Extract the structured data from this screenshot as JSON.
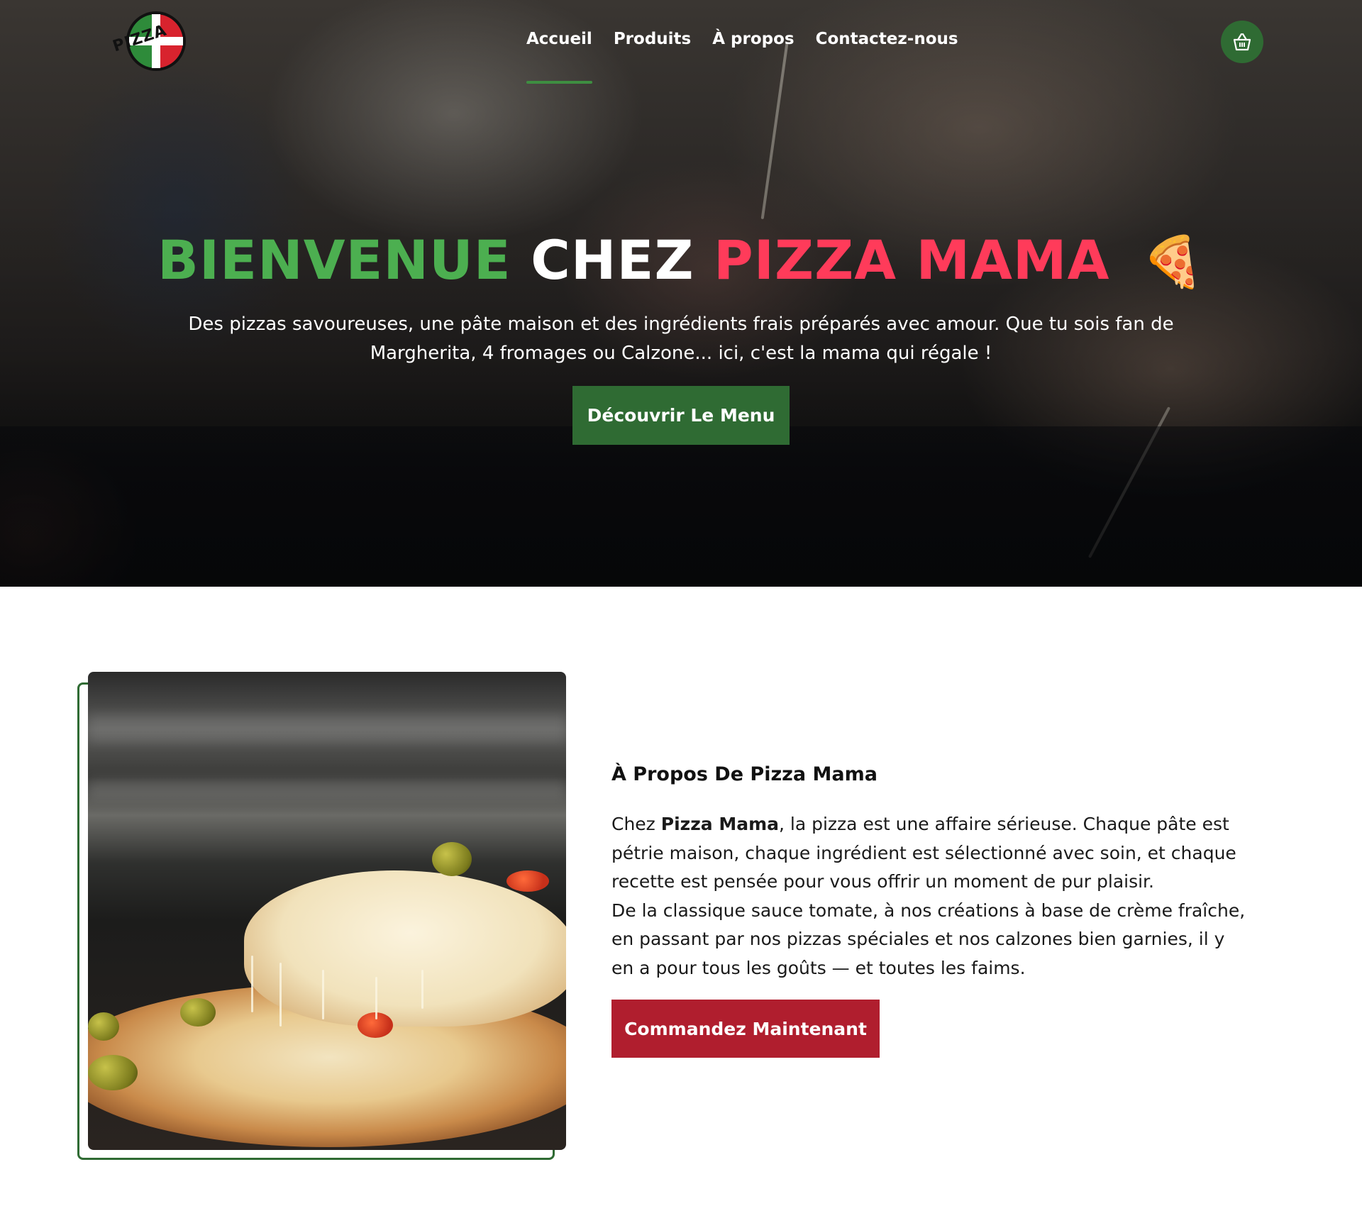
{
  "brand": {
    "logo_text": "PIZZA",
    "colors": {
      "green": "#4caf50",
      "dark_green": "#2f6b33",
      "red": "#ff3b5a",
      "button_red": "#b01e2e"
    }
  },
  "nav": {
    "items": [
      {
        "label": "Accueil",
        "active": true
      },
      {
        "label": "Produits",
        "active": false
      },
      {
        "label": "À propos",
        "active": false
      },
      {
        "label": "Contactez-nous",
        "active": false
      }
    ],
    "cart_icon": "basket-icon"
  },
  "hero": {
    "title_part1": "BIENVENUE",
    "title_part2": "CHEZ",
    "title_part3": "PIZZA MAMA",
    "title_emoji": "🍕",
    "subtitle": "Des pizzas savoureuses, une pâte maison et des ingrédients frais préparés avec amour. Que tu sois fan de Margherita, 4 fromages ou Calzone... ici, c'est la mama qui régale !",
    "button_label": "Découvrir Le Menu"
  },
  "about": {
    "title": "À Propos De Pizza Mama",
    "p1_before": "Chez ",
    "p1_bold": "Pizza Mama",
    "p1_after": ", la pizza est une affaire sérieuse. Chaque pâte est pétrie maison, chaque ingrédient est sélectionné avec soin, et chaque recette est pensée pour vous offrir un moment de pur plaisir.",
    "p2": "De la classique sauce tomate, à nos créations à base de crème fraîche, en passant par nos pizzas spéciales et nos calzones bien garnies, il y en a pour tous les goûts — et toutes les faims.",
    "button_label": "Commandez Maintenant"
  }
}
